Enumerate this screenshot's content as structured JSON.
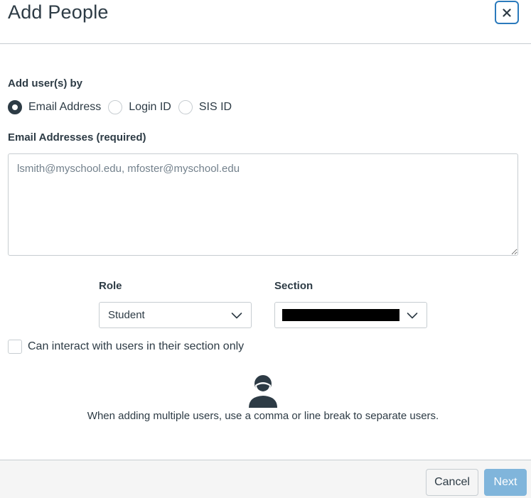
{
  "dialog": {
    "title": "Add People"
  },
  "add_by": {
    "label": "Add user(s) by",
    "options": [
      {
        "label": "Email Address",
        "checked": true
      },
      {
        "label": "Login ID",
        "checked": false
      },
      {
        "label": "SIS ID",
        "checked": false
      }
    ]
  },
  "emails": {
    "label": "Email Addresses (required)",
    "value": "",
    "placeholder": "lsmith@myschool.edu, mfoster@myschool.edu"
  },
  "role": {
    "label": "Role",
    "selected": "Student"
  },
  "section": {
    "label": "Section",
    "selected": ""
  },
  "restrict": {
    "label": "Can interact with users in their section only",
    "checked": false
  },
  "hint": {
    "text": "When adding multiple users, use a comma or line break to separate users."
  },
  "footer": {
    "cancel_label": "Cancel",
    "next_label": "Next"
  },
  "colors": {
    "accent": "#2b7abc",
    "next_button": "#80b5db",
    "text": "#2d3b45",
    "border": "#c7cdd1",
    "footer_bg": "#f5f5f5"
  },
  "icons": {
    "close": "close-icon",
    "chevron": "chevron-down-icon",
    "person": "person-icon"
  }
}
